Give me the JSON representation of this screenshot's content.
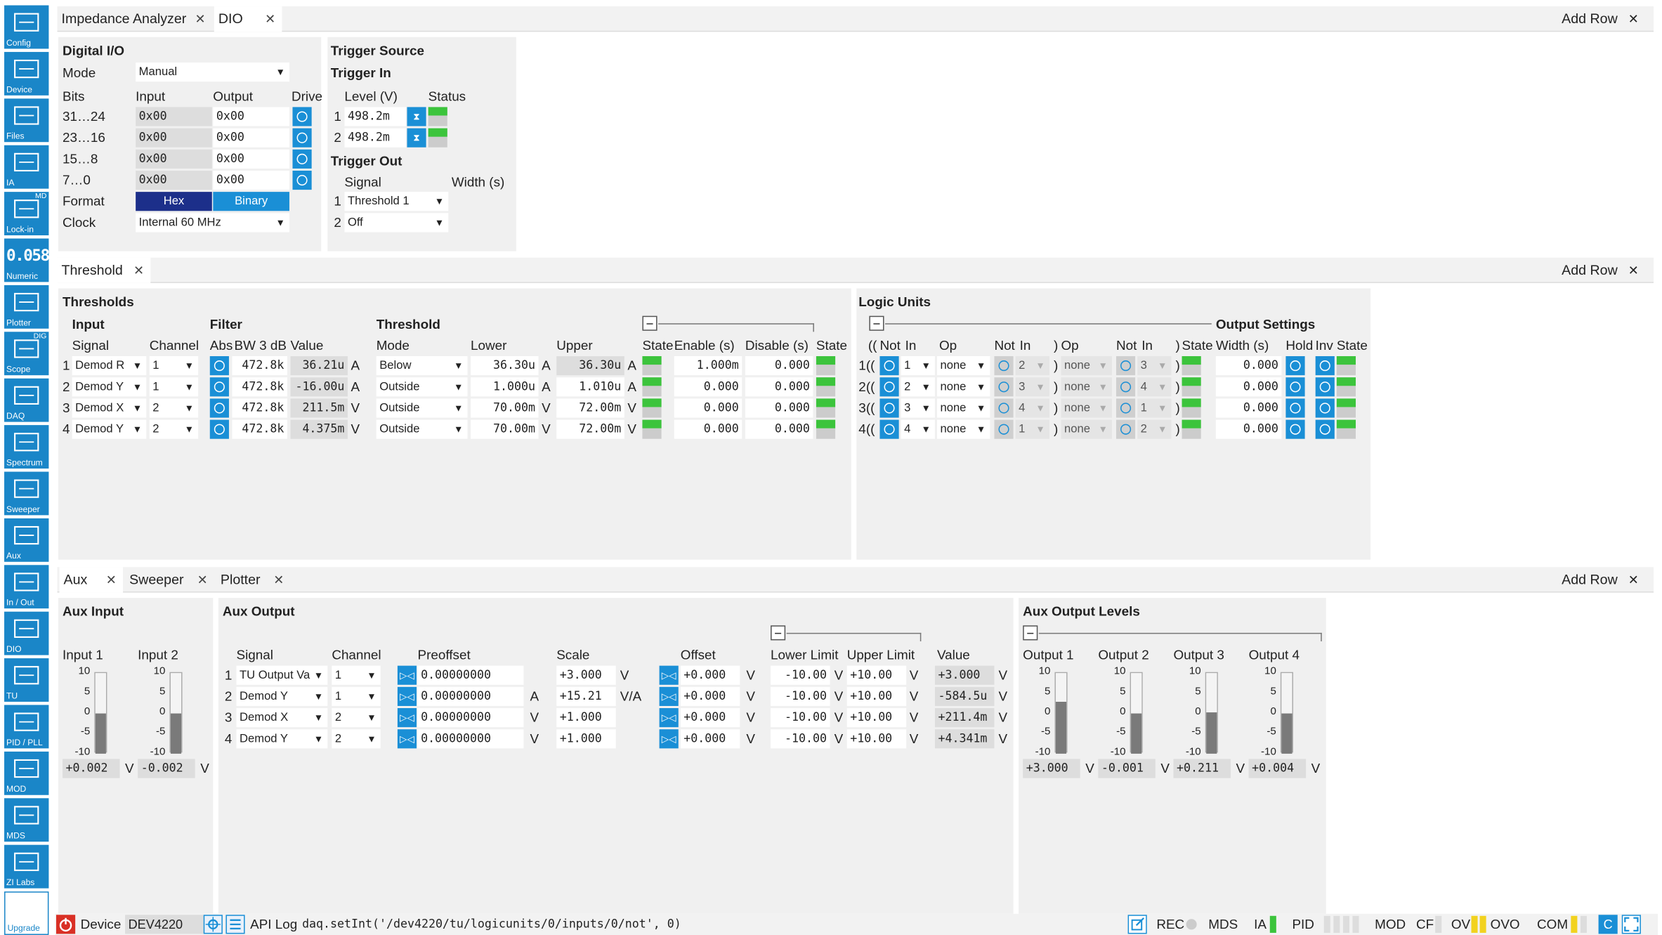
{
  "sidebar": [
    {
      "label": "Config",
      "icon": "gear-icon"
    },
    {
      "label": "Device",
      "icon": "device-icon"
    },
    {
      "label": "Files",
      "icon": "folder-icon"
    },
    {
      "label": "IA",
      "icon": "impedance-analyzer-icon"
    },
    {
      "label": "Lock-in",
      "icon": "lockin-icon",
      "tag": "MD"
    },
    {
      "label": "Numeric",
      "icon": "numeric-icon",
      "glyph": "0.058"
    },
    {
      "label": "Plotter",
      "icon": "plotter-icon"
    },
    {
      "label": "Scope",
      "icon": "scope-icon",
      "tag": "DIG"
    },
    {
      "label": "DAQ",
      "icon": "daq-icon"
    },
    {
      "label": "Spectrum",
      "icon": "spectrum-icon"
    },
    {
      "label": "Sweeper",
      "icon": "sweeper-icon"
    },
    {
      "label": "Aux",
      "icon": "aux-icon"
    },
    {
      "label": "In / Out",
      "icon": "in-out-icon"
    },
    {
      "label": "DIO",
      "icon": "dio-icon"
    },
    {
      "label": "TU",
      "icon": "tu-icon"
    },
    {
      "label": "PID / PLL",
      "icon": "pid-pll-icon"
    },
    {
      "label": "MOD",
      "icon": "mod-icon"
    },
    {
      "label": "MDS",
      "icon": "mds-icon"
    },
    {
      "label": "ZI Labs",
      "icon": "flask-icon"
    },
    {
      "label": "Upgrade",
      "icon": "upgrade-icon"
    }
  ],
  "row1": {
    "tabs": [
      "Impedance Analyzer",
      "DIO"
    ],
    "add_row": "Add Row"
  },
  "dio": {
    "title": "Digital I/O",
    "mode_label": "Mode",
    "mode": "Manual",
    "bits_label": "Bits",
    "input_label": "Input",
    "output_label": "Output",
    "drive_label": "Drive",
    "rows": [
      {
        "bits": "31…24",
        "input": "0x00",
        "output": "0x00"
      },
      {
        "bits": "23…16",
        "input": "0x00",
        "output": "0x00"
      },
      {
        "bits": "15…8",
        "input": "0x00",
        "output": "0x00"
      },
      {
        "bits": "7…0",
        "input": "0x00",
        "output": "0x00"
      }
    ],
    "format_label": "Format",
    "format_hex": "Hex",
    "format_binary": "Binary",
    "clock_label": "Clock",
    "clock": "Internal 60 MHz"
  },
  "trigger": {
    "title": "Trigger Source",
    "in_title": "Trigger In",
    "level_label": "Level (V)",
    "status_label": "Status",
    "in_rows": [
      {
        "n": "1",
        "level": "498.2m"
      },
      {
        "n": "2",
        "level": "498.2m"
      }
    ],
    "out_title": "Trigger Out",
    "signal_label": "Signal",
    "width_label": "Width (s)",
    "out_rows": [
      {
        "n": "1",
        "signal": "Threshold 1"
      },
      {
        "n": "2",
        "signal": "Off"
      }
    ]
  },
  "row2": {
    "tabs": [
      "Threshold"
    ],
    "add_row": "Add Row"
  },
  "thresholds": {
    "title": "Thresholds",
    "input_label": "Input",
    "filter_label": "Filter",
    "threshold_label": "Threshold",
    "cols": {
      "signal": "Signal",
      "channel": "Channel",
      "abs": "Abs",
      "bw": "BW 3 dB",
      "value": "Value",
      "mode": "Mode",
      "lower": "Lower",
      "upper": "Upper",
      "state": "State",
      "enable": "Enable (s)",
      "disable": "Disable (s)",
      "state2": "State"
    },
    "rows": [
      {
        "n": "1",
        "signal": "Demod R",
        "channel": "1",
        "bw": "472.8k",
        "value": "36.21u",
        "vunit": "A",
        "mode": "Below",
        "lower": "36.30u",
        "lunit": "A",
        "upper": "36.30u",
        "uunit": "A",
        "enable": "1.000m",
        "disable": "0.000"
      },
      {
        "n": "2",
        "signal": "Demod Y",
        "channel": "1",
        "bw": "472.8k",
        "value": "-16.00u",
        "vunit": "A",
        "mode": "Outside",
        "lower": "1.000u",
        "lunit": "A",
        "upper": "1.010u",
        "uunit": "A",
        "enable": "0.000",
        "disable": "0.000"
      },
      {
        "n": "3",
        "signal": "Demod X",
        "channel": "2",
        "bw": "472.8k",
        "value": "211.5m",
        "vunit": "V",
        "mode": "Outside",
        "lower": "70.00m",
        "lunit": "V",
        "upper": "72.00m",
        "uunit": "V",
        "enable": "0.000",
        "disable": "0.000"
      },
      {
        "n": "4",
        "signal": "Demod Y",
        "channel": "2",
        "bw": "472.8k",
        "value": "4.375m",
        "vunit": "V",
        "mode": "Outside",
        "lower": "70.00m",
        "lunit": "V",
        "upper": "72.00m",
        "uunit": "V",
        "enable": "0.000",
        "disable": "0.000"
      }
    ]
  },
  "logic": {
    "title": "Logic Units",
    "output_title": "Output Settings",
    "cols": {
      "open": "((",
      "not1": "Not",
      "in1": "In",
      "op1": "Op",
      "not2": "Not",
      "in2": "In",
      "close": ")",
      "op2": "Op",
      "not3": "Not",
      "in3": "In",
      "close2": ")",
      "state": "State",
      "width": "Width (s)",
      "hold": "Hold",
      "inv": "Inv",
      "state2": "State"
    },
    "rows": [
      {
        "n": "1",
        "in1": "1",
        "op1": "none",
        "in2": "2",
        "op2": "none",
        "in3": "3",
        "width": "0.000"
      },
      {
        "n": "2",
        "in1": "2",
        "op1": "none",
        "in2": "3",
        "op2": "none",
        "in3": "4",
        "width": "0.000"
      },
      {
        "n": "3",
        "in1": "3",
        "op1": "none",
        "in2": "4",
        "op2": "none",
        "in3": "1",
        "width": "0.000"
      },
      {
        "n": "4",
        "in1": "4",
        "op1": "none",
        "in2": "1",
        "op2": "none",
        "in3": "2",
        "width": "0.000"
      }
    ],
    "paren_open": "((",
    "paren_close": ")"
  },
  "row3": {
    "tabs": [
      "Aux",
      "Sweeper",
      "Plotter"
    ],
    "add_row": "Add Row"
  },
  "aux_input": {
    "title": "Aux Input",
    "inputs": [
      {
        "label": "Input 1",
        "value": "+0.002",
        "unit": "V",
        "level": 0.0002
      },
      {
        "label": "Input 2",
        "value": "-0.002",
        "unit": "V",
        "level": -0.0002
      }
    ],
    "ticks": [
      "10",
      "5",
      "0",
      "-5",
      "-10"
    ]
  },
  "aux_output": {
    "title": "Aux Output",
    "cols": {
      "signal": "Signal",
      "channel": "Channel",
      "preoffset": "Preoffset",
      "scale": "Scale",
      "offset": "Offset",
      "lower": "Lower Limit",
      "upper": "Upper Limit",
      "value": "Value"
    },
    "rows": [
      {
        "n": "1",
        "signal": "TU Output Va",
        "channel": "1",
        "preoffset": "0.00000000",
        "punit": "",
        "scale": "+3.000",
        "sunit": "V",
        "offset": "+0.000",
        "ounit": "V",
        "lower": "-10.00",
        "lunit": "V",
        "upper": "+10.00",
        "uunit": "V",
        "value": "+3.000",
        "vunit": "V"
      },
      {
        "n": "2",
        "signal": "Demod Y",
        "channel": "1",
        "preoffset": "0.00000000",
        "punit": "A",
        "scale": "+15.21",
        "sunit": "V/A",
        "offset": "+0.000",
        "ounit": "V",
        "lower": "-10.00",
        "lunit": "V",
        "upper": "+10.00",
        "uunit": "V",
        "value": "-584.5u",
        "vunit": "V"
      },
      {
        "n": "3",
        "signal": "Demod X",
        "channel": "2",
        "preoffset": "0.00000000",
        "punit": "V",
        "scale": "+1.000",
        "sunit": "",
        "offset": "+0.000",
        "ounit": "V",
        "lower": "-10.00",
        "lunit": "V",
        "upper": "+10.00",
        "uunit": "V",
        "value": "+211.4m",
        "vunit": "V"
      },
      {
        "n": "4",
        "signal": "Demod Y",
        "channel": "2",
        "preoffset": "0.00000000",
        "punit": "V",
        "scale": "+1.000",
        "sunit": "",
        "offset": "+0.000",
        "ounit": "V",
        "lower": "-10.00",
        "lunit": "V",
        "upper": "+10.00",
        "uunit": "V",
        "value": "+4.341m",
        "vunit": "V"
      }
    ]
  },
  "aux_levels": {
    "title": "Aux Output Levels",
    "outputs": [
      {
        "label": "Output 1",
        "value": "+3.000",
        "unit": "V",
        "level": 3.0
      },
      {
        "label": "Output 2",
        "value": "-0.001",
        "unit": "V",
        "level": -0.001
      },
      {
        "label": "Output 3",
        "value": "+0.211",
        "unit": "V",
        "level": 0.211
      },
      {
        "label": "Output 4",
        "value": "+0.004",
        "unit": "V",
        "level": 0.004
      }
    ],
    "ticks": [
      "10",
      "5",
      "0",
      "-5",
      "-10"
    ]
  },
  "status": {
    "device_label": "Device",
    "device": "DEV4220",
    "apilog_label": "API Log",
    "command": "daq.setInt('/dev4220/tu/logicunits/0/inputs/0/not', 0)",
    "rec": "REC",
    "mds": "MDS",
    "ia": "IA",
    "pid": "PID",
    "mod": "MOD",
    "cf": "CF",
    "ovi": "OVI",
    "ovo": "OVO",
    "com": "COM",
    "c": "C"
  },
  "colors": {
    "accent": "#1a8fd6",
    "sidebar": "#1a86c8",
    "led_green": "#3cc43c",
    "format_active": "#1c2f8a"
  }
}
